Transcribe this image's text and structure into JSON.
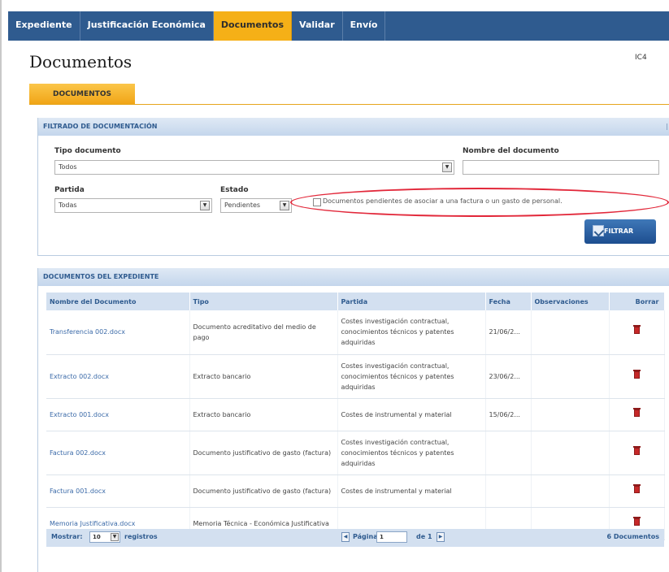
{
  "nav": {
    "items": [
      {
        "label": "Expediente",
        "active": false
      },
      {
        "label": "Justificación Económica",
        "active": false
      },
      {
        "label": "Documentos",
        "active": true
      },
      {
        "label": "Validar",
        "active": false
      },
      {
        "label": "Envío",
        "active": false
      }
    ]
  },
  "page": {
    "title": "Documentos",
    "code": "IC4",
    "tab_label": "DOCUMENTOS"
  },
  "filter": {
    "header": "FILTRADO DE DOCUMENTACIÓN",
    "tipo_label": "Tipo documento",
    "tipo_value": "Todos",
    "nombre_label": "Nombre del documento",
    "nombre_value": "",
    "partida_label": "Partida",
    "partida_value": "Todas",
    "estado_label": "Estado",
    "estado_value": "Pendientes",
    "checkbox_label": "Documentos pendientes de asociar a una factura o un gasto de personal.",
    "checkbox_checked": false,
    "button_label": "FILTRAR"
  },
  "docs": {
    "header": "DOCUMENTOS DEL EXPEDIENTE",
    "columns": [
      "Nombre del Documento",
      "Tipo",
      "Partida",
      "Fecha",
      "Observaciones",
      "Borrar"
    ],
    "rows": [
      {
        "name": "Transferencia 002.docx",
        "tipo": "Documento acreditativo del medio de pago",
        "partida": "Costes investigación contractual, conocimientos técnicos y patentes adquiridas",
        "fecha": "21/06/2...",
        "obs": ""
      },
      {
        "name": "Extracto 002.docx",
        "tipo": "Extracto bancario",
        "partida": "Costes investigación contractual, conocimientos técnicos y patentes adquiridas",
        "fecha": "23/06/2...",
        "obs": ""
      },
      {
        "name": "Extracto 001.docx",
        "tipo": "Extracto bancario",
        "partida": "Costes de instrumental y material",
        "fecha": "15/06/2...",
        "obs": ""
      },
      {
        "name": "Factura 002.docx",
        "tipo": "Documento justificativo de gasto (factura)",
        "partida": "Costes investigación contractual, conocimientos técnicos y patentes adquiridas",
        "fecha": "",
        "obs": ""
      },
      {
        "name": "Factura 001.docx",
        "tipo": "Documento justificativo de gasto (factura)",
        "partida": "Costes de instrumental y material",
        "fecha": "",
        "obs": ""
      },
      {
        "name": "Memoria Justificativa.docx",
        "tipo": "Memoria Técnica - Económica Justificativa",
        "partida": "",
        "fecha": "",
        "obs": ""
      }
    ],
    "pager": {
      "show_label": "Mostrar:",
      "per_page": "10",
      "registros_label": "registros",
      "page_label": "Página",
      "page_value": "1",
      "of_label": "de 1",
      "count_label": "6 Documentos"
    }
  },
  "colors": {
    "nav_bg": "#2f5b8f",
    "nav_active": "#f5b017",
    "highlight": "#e2283a",
    "link": "#3b6aa8"
  }
}
